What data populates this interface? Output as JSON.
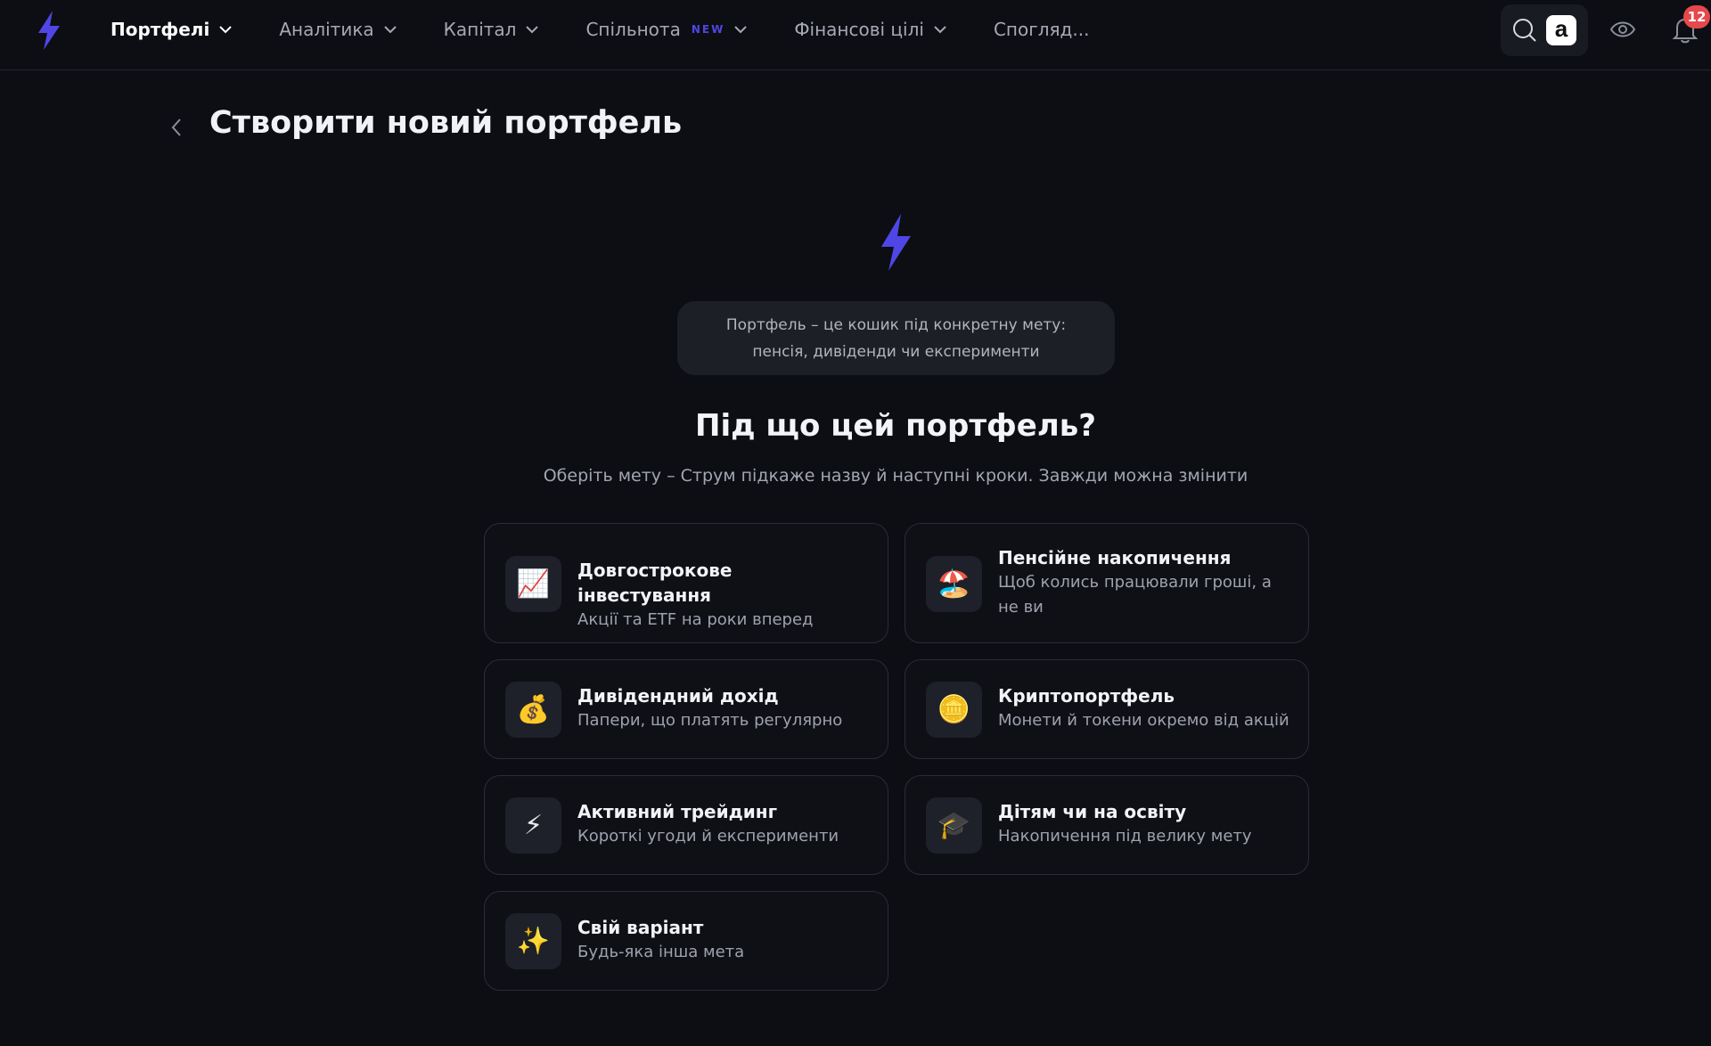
{
  "nav": {
    "items": [
      {
        "label": "Портфелі",
        "active": true,
        "badge": ""
      },
      {
        "label": "Аналітика",
        "active": false,
        "badge": ""
      },
      {
        "label": "Капітал",
        "active": false,
        "badge": ""
      },
      {
        "label": "Спільнота",
        "active": false,
        "badge": "NEW"
      },
      {
        "label": "Фінансові цілі",
        "active": false,
        "badge": ""
      }
    ],
    "last_item": "Спогляд..."
  },
  "toolbar": {
    "amazon_letter": "a",
    "notifications_count": "12"
  },
  "page": {
    "title": "Створити новий портфель"
  },
  "intro": {
    "line1": "Портфель – це кошик під конкретну мету:",
    "line2": "пенсія, дивіденди чи експерименти"
  },
  "question": {
    "title": "Під що цей портфель?",
    "subtitle": "Оберіть мету – Струм підкаже назву й наступні кроки. Завжди можна змінити"
  },
  "goals": [
    {
      "icon": "📈",
      "icon_name": "chart-increasing-icon",
      "title": "Довгострокове інвестування",
      "desc": "Акції та ETF на роки вперед"
    },
    {
      "icon": "🏖️",
      "icon_name": "beach-umbrella-icon",
      "title": "Пенсійне накопичення",
      "desc": "Щоб колись працювали гроші, а не ви"
    },
    {
      "icon": "💰",
      "icon_name": "money-bag-icon",
      "title": "Дивідендний дохід",
      "desc": "Папери, що платять регулярно"
    },
    {
      "icon": "🪙",
      "icon_name": "coin-icon",
      "title": "Криптопортфель",
      "desc": "Монети й токени окремо від акцій"
    },
    {
      "icon": "⚡",
      "icon_name": "lightning-icon",
      "title": "Активний трейдинг",
      "desc": "Короткі угоди й експерименти"
    },
    {
      "icon": "🎓",
      "icon_name": "graduation-cap-icon",
      "title": "Дітям чи на освіту",
      "desc": "Накопичення під велику мету"
    },
    {
      "icon": "✨",
      "icon_name": "sparkles-icon",
      "title": "Свій варіант",
      "desc": "Будь-яка інша мета"
    }
  ],
  "colors": {
    "background": "#0c0e13",
    "accent": "#4f46e5",
    "card_border": "#2a2d36",
    "badge": "#e5484d"
  }
}
